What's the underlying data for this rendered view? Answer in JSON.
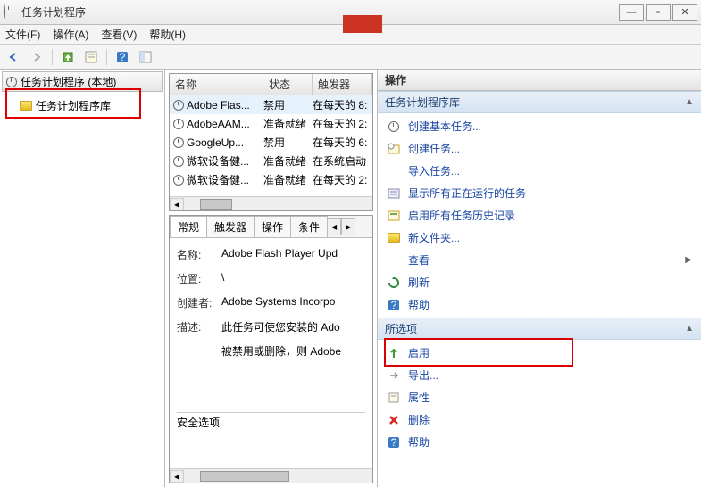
{
  "window": {
    "title": "任务计划程序",
    "minimize": "—",
    "maximize": "▫",
    "close": "✕"
  },
  "menu": {
    "file": "文件(F)",
    "action": "操作(A)",
    "view": "查看(V)",
    "help": "帮助(H)"
  },
  "tree": {
    "root": "任务计划程序 (本地)",
    "library": "任务计划程序库"
  },
  "listHeaders": {
    "name": "名称",
    "status": "状态",
    "trigger": "触发器"
  },
  "tasks": [
    {
      "name": "Adobe Flas...",
      "status": "禁用",
      "trigger": "在每天的 8:"
    },
    {
      "name": "AdobeAAM...",
      "status": "准备就绪",
      "trigger": "在每天的 2:"
    },
    {
      "name": "GoogleUp...",
      "status": "禁用",
      "trigger": "在每天的 6:"
    },
    {
      "name": "微软设备健...",
      "status": "准备就绪",
      "trigger": "在系统启动"
    },
    {
      "name": "微软设备健...",
      "status": "准备就绪",
      "trigger": "在每天的 2:"
    }
  ],
  "tabs": {
    "general": "常规",
    "triggers": "触发器",
    "actions": "操作",
    "conditions": "条件"
  },
  "details": {
    "nameLabel": "名称:",
    "nameValue": "Adobe Flash Player Upd",
    "locationLabel": "位置:",
    "locationValue": "\\",
    "authorLabel": "创建者:",
    "authorValue": "Adobe Systems Incorpo",
    "descLabel": "描述:",
    "descValue1": "此任务可使您安装的 Ado",
    "descValue2": "被禁用或删除，则 Adobe",
    "security": "安全选项"
  },
  "actions": {
    "header": "操作",
    "section1": "任务计划程序库",
    "items1": [
      {
        "id": "create-basic",
        "label": "创建基本任务..."
      },
      {
        "id": "create-task",
        "label": "创建任务..."
      },
      {
        "id": "import",
        "label": "导入任务..."
      },
      {
        "id": "show-running",
        "label": "显示所有正在运行的任务"
      },
      {
        "id": "enable-history",
        "label": "启用所有任务历史记录"
      },
      {
        "id": "new-folder",
        "label": "新文件夹..."
      },
      {
        "id": "view",
        "label": "查看",
        "expand": true
      },
      {
        "id": "refresh",
        "label": "刷新"
      },
      {
        "id": "help1",
        "label": "帮助"
      }
    ],
    "section2": "所选项",
    "items2": [
      {
        "id": "enable",
        "label": "启用"
      },
      {
        "id": "export",
        "label": "导出..."
      },
      {
        "id": "properties",
        "label": "属性"
      },
      {
        "id": "delete",
        "label": "删除"
      },
      {
        "id": "help2",
        "label": "帮助"
      }
    ]
  }
}
